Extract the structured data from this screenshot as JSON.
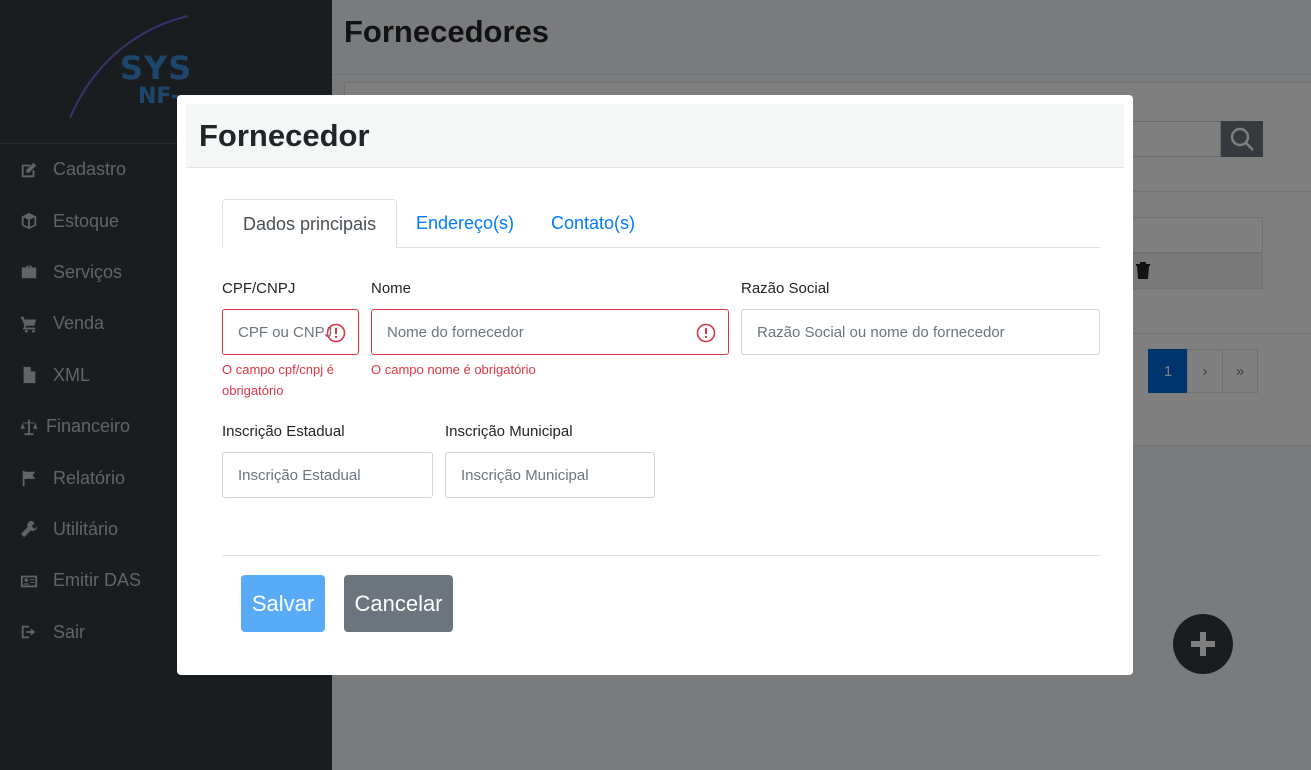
{
  "logo": {
    "text": "SYS",
    "sub": "NF-"
  },
  "sidebar": {
    "items": [
      {
        "label": "Cadastro",
        "icon": "edit-icon"
      },
      {
        "label": "Estoque",
        "icon": "cube-icon"
      },
      {
        "label": "Serviços",
        "icon": "briefcase-icon"
      },
      {
        "label": "Venda",
        "icon": "cart-icon"
      },
      {
        "label": "XML",
        "icon": "file-icon"
      },
      {
        "label": "Financeiro",
        "icon": "balance-scale-icon"
      },
      {
        "label": "Relatório",
        "icon": "flag-icon"
      },
      {
        "label": "Utilitário",
        "icon": "wrench-icon"
      },
      {
        "label": "Emitir DAS",
        "icon": "id-card-icon"
      },
      {
        "label": "Sair",
        "icon": "sign-out-icon"
      }
    ]
  },
  "page": {
    "title": "Fornecedores"
  },
  "pagination": {
    "current": "1",
    "next": "›",
    "last": "»"
  },
  "modal": {
    "title": "Fornecedor",
    "tabs": [
      {
        "label": "Dados principais",
        "active": true
      },
      {
        "label": "Endereço(s)",
        "active": false
      },
      {
        "label": "Contato(s)",
        "active": false
      }
    ],
    "fields": {
      "cpf": {
        "label": "CPF/CNPJ",
        "placeholder": "CPF ou CNPJ",
        "error": "O campo cpf/cnpj é obrigatório"
      },
      "nome": {
        "label": "Nome",
        "placeholder": "Nome do fornecedor",
        "error": "O campo nome é obrigatório"
      },
      "razao": {
        "label": "Razão Social",
        "placeholder": "Razão Social ou nome do fornecedor"
      },
      "ie": {
        "label": "Inscrição Estadual",
        "placeholder": "Inscrição Estadual"
      },
      "im": {
        "label": "Inscrição Municipal",
        "placeholder": "Inscrição Municipal"
      }
    },
    "buttons": {
      "save": "Salvar",
      "cancel": "Cancelar"
    }
  },
  "colors": {
    "sidebar_bg": "#343a40",
    "primary": "#007bff",
    "save_button": "#5aabf7",
    "cancel_button": "#6c757d",
    "error": "#dc3545"
  }
}
